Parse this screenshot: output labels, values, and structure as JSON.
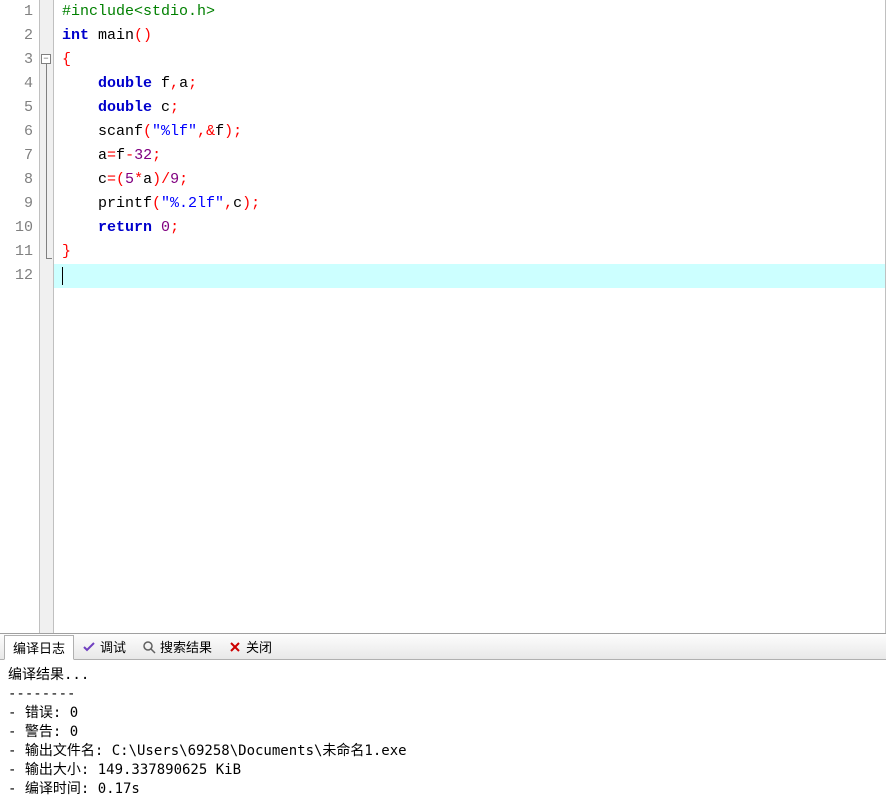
{
  "code": {
    "lines": [
      {
        "n": "1"
      },
      {
        "n": "2"
      },
      {
        "n": "3"
      },
      {
        "n": "4"
      },
      {
        "n": "5"
      },
      {
        "n": "6"
      },
      {
        "n": "7"
      },
      {
        "n": "8"
      },
      {
        "n": "9"
      },
      {
        "n": "10"
      },
      {
        "n": "11"
      },
      {
        "n": "12"
      }
    ],
    "l1_preproc": "#include<stdio.h>",
    "l2_kw1": "int",
    "l2_ident": " main",
    "l2_paren": "()",
    "l3_brace": "{",
    "l4_kw": "double",
    "l4_rest_i1": " f",
    "l4_p1": ",",
    "l4_rest_i2": "a",
    "l4_p2": ";",
    "l5_kw": "double",
    "l5_i": " c",
    "l5_p": ";",
    "l6_fn": "scanf",
    "l6_op": "(",
    "l6_str": "\"%lf\"",
    "l6_p1": ",&",
    "l6_i": "f",
    "l6_cp": ");",
    "l7_i1": "a",
    "l7_eq": "=",
    "l7_i2": "f",
    "l7_op": "-",
    "l7_n": "32",
    "l7_p": ";",
    "l8_i1": "c",
    "l8_eq": "=(",
    "l8_n1": "5",
    "l8_op1": "*",
    "l8_i2": "a",
    "l8_cp": ")/",
    "l8_n2": "9",
    "l8_p": ";",
    "l9_fn": "printf",
    "l9_op": "(",
    "l9_str": "\"%.2lf\"",
    "l9_p1": ",",
    "l9_i": "c",
    "l9_cp": ");",
    "l10_kw": "return",
    "l10_sp": " ",
    "l10_n": "0",
    "l10_p": ";",
    "l11_brace": "}"
  },
  "tabs": {
    "compile_log": "编译日志",
    "debug": "调试",
    "search_results": "搜索结果",
    "close": "关闭"
  },
  "output": {
    "title": "编译结果...",
    "sep": "--------",
    "err": "- 错误: 0",
    "warn": "- 警告: 0",
    "outfile": "- 输出文件名: C:\\Users\\69258\\Documents\\未命名1.exe",
    "outsize": "- 输出大小: 149.337890625 KiB",
    "time": "- 编译时间: 0.17s"
  }
}
